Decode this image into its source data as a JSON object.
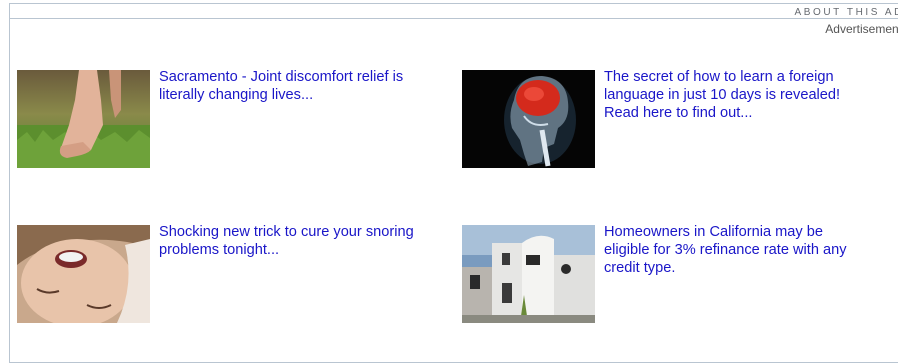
{
  "header": {
    "about_label": "ABOUT THIS AD",
    "advertisement_label": "Advertisement"
  },
  "colors": {
    "link": "#1a16c8",
    "border": "#b9c5d1",
    "label": "#666a70"
  },
  "ads": [
    {
      "image": "bare-foot-on-grass-photo",
      "headline": "Sacramento - Joint discomfort relief is literally changing lives..."
    },
    {
      "image": "xray-head-brain-photo",
      "headline": "The secret of how to learn a foreign language in just 10 days is revealed! Read here to find out..."
    },
    {
      "image": "sleeping-face-snoring-photo",
      "headline": "Shocking new trick to cure your snoring problems tonight..."
    },
    {
      "image": "white-modern-house-photo",
      "headline": "Homeowners in California may be eligible for 3% refinance rate with any credit type."
    }
  ]
}
